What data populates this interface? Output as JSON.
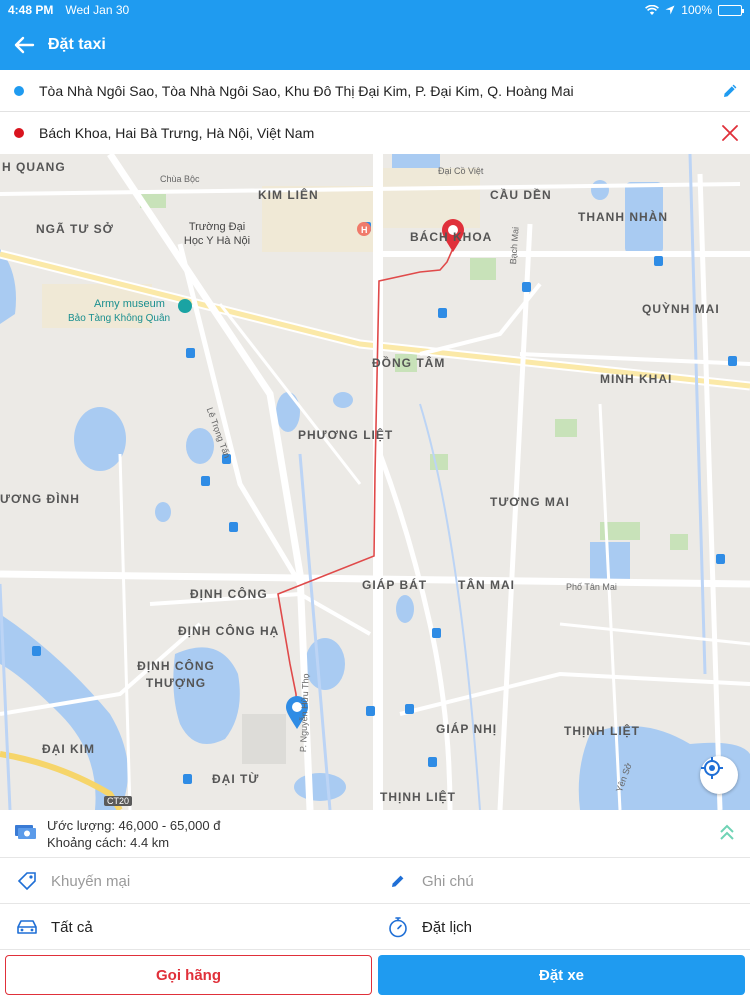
{
  "status": {
    "time": "4:48 PM",
    "date": "Wed Jan 30",
    "battery": "100%"
  },
  "header": {
    "title": "Đặt taxi"
  },
  "route": {
    "from": "Tòa Nhà Ngôi Sao, Tòa Nhà Ngôi Sao, Khu Đô Thị Đại Kim, P. Đại Kim, Q. Hoàng Mai",
    "to": "Bách Khoa, Hai Bà Trưng, Hà Nội, Việt Nam"
  },
  "map": {
    "labels": [
      "H QUANG",
      "NGÃ TƯ SỞ",
      "KIM LIÊN",
      "BÁCH KHOA",
      "CẦU DỀN",
      "THANH NHÀN",
      "QUỲNH MAI",
      "ĐỒNG TÂM",
      "MINH KHAI",
      "PHƯƠNG LIỆT",
      "ƯƠNG ĐÌNH",
      "TƯƠNG MAI",
      "GIÁP BÁT",
      "TÂN MAI",
      "ĐỊNH CÔNG",
      "ĐỊNH CÔNG HẠ",
      "ĐỊNH CÔNG THƯỢNG",
      "ĐẠI KIM",
      "ĐẠI TỪ",
      "GIÁP NHỊ",
      "THỊNH LIỆT",
      "THỊNH LIỆT"
    ],
    "streets": [
      "Chùa Bộc",
      "Đại Cồ Việt",
      "Bạch Mai",
      "Lê Trọng Tấn",
      "Phố Tân Mai",
      "CT20",
      "Yên Sở",
      "P. Nguyễn Hữu Thọ"
    ],
    "pois": {
      "school": "Trường Đại Học Y Hà Nội",
      "museum": "Army museum",
      "museum_sub": "Bảo Tàng Không Quân"
    },
    "colors": {
      "origin": "#1f9bf0",
      "destination": "#e0303a",
      "route": "#e04a4a"
    }
  },
  "estimate": {
    "price": "Ước lượng: 46,000 - 65,000 đ",
    "distance": "Khoảng cách: 4.4 km"
  },
  "options": {
    "promo_placeholder": "Khuyến mại",
    "note_placeholder": "Ghi chú",
    "vehicle_type": "Tất cả",
    "schedule": "Đặt lịch"
  },
  "actions": {
    "call_label": "Gọi hãng",
    "book_label": "Đặt xe"
  }
}
